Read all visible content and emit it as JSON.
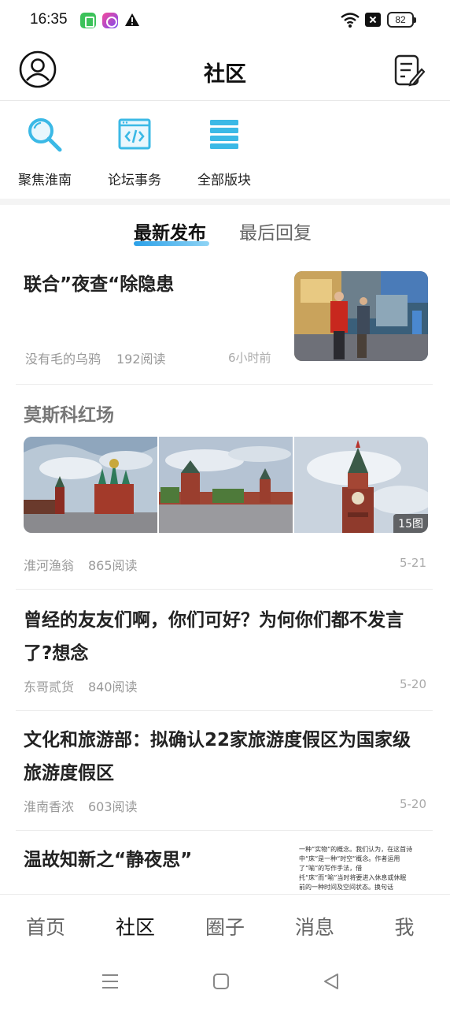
{
  "status_bar": {
    "time": "16:35",
    "battery": "82"
  },
  "header": {
    "title": "社区"
  },
  "shortcuts": [
    {
      "label": "聚焦淮南",
      "icon": "search-icon"
    },
    {
      "label": "论坛事务",
      "icon": "code-window-icon"
    },
    {
      "label": "全部版块",
      "icon": "list-icon"
    }
  ],
  "tabs": {
    "active": "最新发布",
    "inactive": "最后回复"
  },
  "posts": [
    {
      "title": "联合”夜查“除隐患",
      "author": "没有毛的乌鸦",
      "reads": "192阅读",
      "time": "6小时前"
    },
    {
      "title": "莫斯科红场",
      "author": "淮河渔翁",
      "reads": "865阅读",
      "time": "5-21",
      "image_count": "15图"
    },
    {
      "title": "曾经的友友们啊，你们可好？为何你们都不发言了?想念",
      "author": "东哥贰货",
      "reads": "840阅读",
      "time": "5-20"
    },
    {
      "title": "文化和旅游部：拟确认22家旅游度假区为国家级旅游度假区",
      "author": "淮南香浓",
      "reads": "603阅读",
      "time": "5-20"
    },
    {
      "title": "温故知新之“静夜思”",
      "snippet_line1": "一种“实物”的概念。我们认为，在这首诗",
      "snippet_line2": "中“床”是一种“时空”概念。作者运用",
      "snippet_line3": "了“喻”的写作手法，借",
      "snippet_line4": "托“床”而“喻”当时将要进入休息或休眠",
      "snippet_line5": "前的一种时间及空间状态。换句话"
    }
  ],
  "bottom_nav": [
    "首页",
    "社区",
    "圈子",
    "消息",
    "我"
  ]
}
